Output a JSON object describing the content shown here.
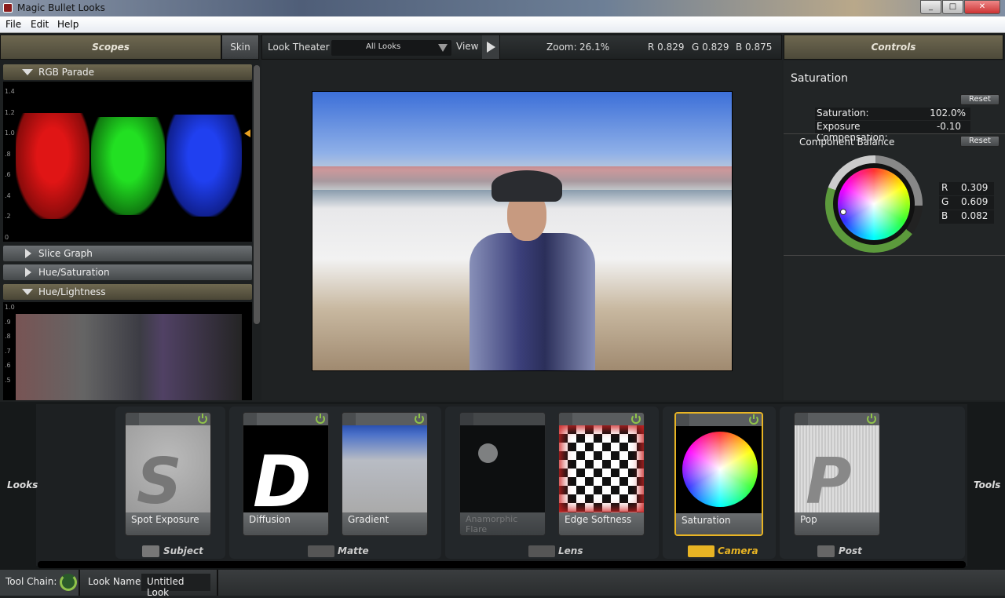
{
  "window": {
    "title": "Magic Bullet Looks",
    "min": "_",
    "max": "□",
    "close": "✕"
  },
  "menu": [
    "File",
    "Edit",
    "Help"
  ],
  "header": {
    "scopes": "Scopes",
    "skin": "Skin",
    "look_theater": "Look Theater",
    "filter": "All Looks",
    "view": "View",
    "zoom_label": "Zoom:",
    "zoom_value": "26.1%",
    "r": "R 0.829",
    "g": "G 0.829",
    "b": "B 0.875",
    "controls": "Controls"
  },
  "scopes": {
    "rgb_parade": "RGB Parade",
    "rgb_axis": [
      "1.4",
      "1.2",
      "1.0",
      ".8",
      ".6",
      ".4",
      ".2",
      "0"
    ],
    "slice_graph": "Slice Graph",
    "hue_saturation": "Hue/Saturation",
    "hue_lightness": "Hue/Lightness",
    "hl_axis": [
      "1.0",
      ".9",
      ".8",
      ".7",
      ".6",
      ".5"
    ]
  },
  "controls": {
    "title": "Saturation",
    "reset": "Reset",
    "saturation_label": "Saturation:",
    "saturation_value": "102.0%",
    "exposure_label": "Exposure Compensation:",
    "exposure_value": "-0.10",
    "balance_title": "Component Balance",
    "balance_reset": "Reset",
    "r_label": "R",
    "r_value": "0.309",
    "g_label": "G",
    "g_value": "0.609",
    "b_label": "B",
    "b_value": "0.082"
  },
  "tools": {
    "left_label": "Looks",
    "right_label": "Tools",
    "cards": [
      {
        "label": "Spot Exposure",
        "enabled": true
      },
      {
        "label": "Diffusion",
        "enabled": true
      },
      {
        "label": "Gradient",
        "enabled": true
      },
      {
        "label": "Anamorphic Flare",
        "enabled": false
      },
      {
        "label": "Edge Softness",
        "enabled": true
      },
      {
        "label": "Saturation",
        "enabled": true,
        "selected": true
      },
      {
        "label": "Pop",
        "enabled": true
      }
    ],
    "groups": [
      "Subject",
      "Matte",
      "Lens",
      "Camera",
      "Post"
    ],
    "accent": "#e8b424"
  },
  "status": {
    "tool_chain": "Tool Chain:",
    "look_name_label": "Look Name:",
    "look_name": "Untitled Look"
  }
}
